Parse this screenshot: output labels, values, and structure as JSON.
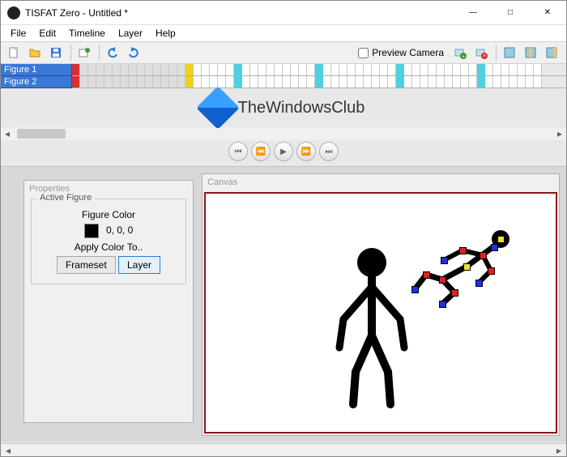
{
  "window": {
    "title": "TISFAT Zero - Untitled *"
  },
  "menubar": {
    "items": [
      "File",
      "Edit",
      "Timeline",
      "Layer",
      "Help"
    ]
  },
  "toolbar": {
    "new_icon": "new-file-icon",
    "open_icon": "open-folder-icon",
    "save_icon": "save-disk-icon",
    "export_icon": "export-icon",
    "undo_icon": "undo-icon",
    "redo_icon": "redo-icon",
    "preview_camera_label": "Preview Camera",
    "preview_camera_checked": false,
    "add_layer_icon": "layer-add-icon",
    "remove_layer_icon": "layer-remove-icon",
    "group1_icon": "frameset-a-icon",
    "group2_icon": "frameset-b-icon",
    "group3_icon": "frameset-c-icon"
  },
  "timeline": {
    "layers": [
      "Figure 1",
      "Figure 2"
    ],
    "selected_frame": 15,
    "key_markers": {
      "row1": [
        {
          "col": 0,
          "type": "red"
        },
        {
          "col": 14,
          "type": "yellow"
        }
      ],
      "row2": [
        {
          "col": 0,
          "type": "red"
        },
        {
          "col": 14,
          "type": "yellow"
        }
      ]
    },
    "playhead_cols": [
      20,
      30,
      40,
      50
    ]
  },
  "watermark": {
    "text": "TheWindowsClub"
  },
  "playback": {
    "first": "⏮",
    "prev": "⏪",
    "play": "▶",
    "next": "⏩",
    "last": "⏭"
  },
  "properties": {
    "title": "Properties",
    "legend": "Active Figure",
    "figure_color_label": "Figure Color",
    "figure_color_value": "0, 0, 0",
    "apply_label": "Apply Color To..",
    "frameset_btn": "Frameset",
    "layer_btn": "Layer"
  },
  "canvas": {
    "title": "Canvas"
  }
}
